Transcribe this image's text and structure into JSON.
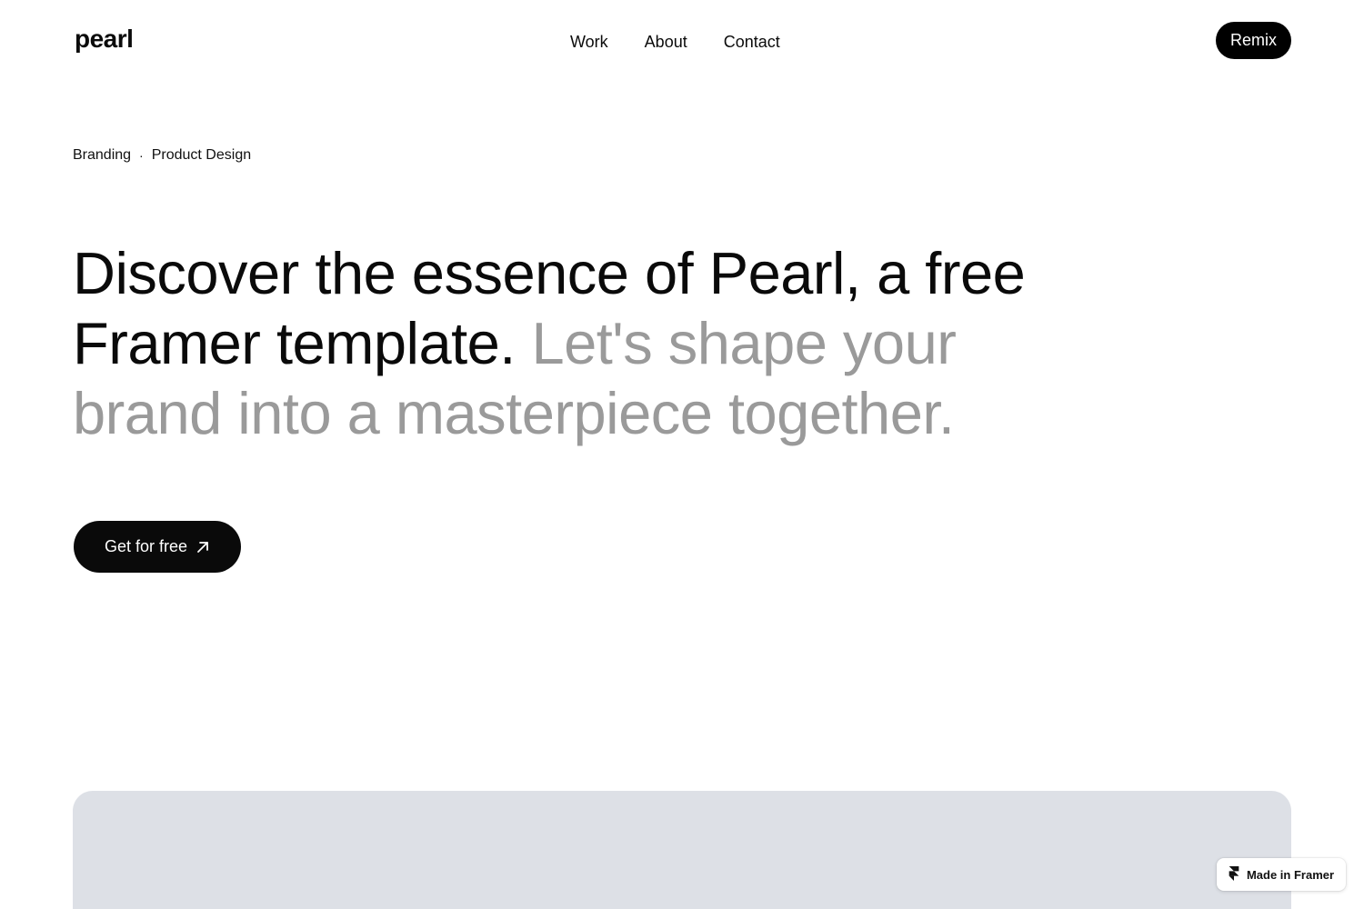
{
  "header": {
    "logo": "pearl",
    "nav": [
      {
        "label": "Work"
      },
      {
        "label": "About"
      },
      {
        "label": "Contact"
      }
    ],
    "remix_label": "Remix"
  },
  "hero": {
    "tags": [
      "Branding",
      "Product Design"
    ],
    "tag_separator": "·",
    "headline_dark": "Discover the essence of Pearl, a free Framer template.",
    "headline_muted": "Let's shape your brand into a masterpiece together.",
    "cta_label": "Get for free",
    "cta_icon": "arrow-up-right-icon"
  },
  "badge": {
    "label": "Made in Framer",
    "icon": "framer-logo-icon"
  },
  "colors": {
    "text": "#0a0a0a",
    "muted_text": "#9a9a9a",
    "button_bg": "#000000",
    "panel_bg": "#dde0e6"
  }
}
